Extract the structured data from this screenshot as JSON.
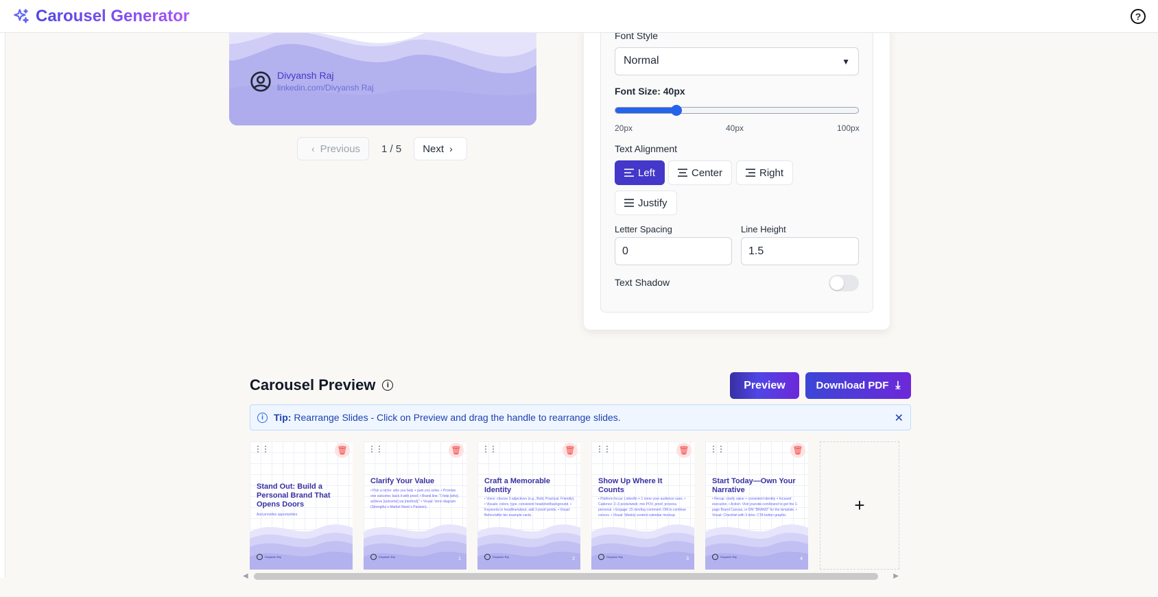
{
  "header": {
    "title": "Carousel Generator",
    "help": "?"
  },
  "editor_preview": {
    "author_name": "Divyansh Raj",
    "author_handle": "linkedin.com/Divyansh Raj",
    "pager": {
      "previous": "Previous",
      "next": "Next",
      "count": "1 / 5"
    }
  },
  "panel": {
    "font_style_label": "Font Style",
    "font_style_value": "Normal",
    "font_size_label": "Font Size: 40px",
    "font_size_fraction": 0.25,
    "slider_ticks": [
      "20px",
      "40px",
      "100px"
    ],
    "text_alignment_label": "Text Alignment",
    "align_left": "Left",
    "align_center": "Center",
    "align_right": "Right",
    "align_justify": "Justify",
    "letter_spacing_label": "Letter Spacing",
    "letter_spacing_value": "0",
    "line_height_label": "Line Height",
    "line_height_value": "1.5",
    "text_shadow_label": "Text Shadow"
  },
  "carousel": {
    "title": "Carousel Preview",
    "preview_button": "Preview",
    "download_button": "Download PDF",
    "tip_label": "Tip:",
    "tip_text": "Rearrange Slides - Click on Preview and drag the handle to rearrange slides.",
    "slides": [
      {
        "title": "Stand Out: Build a Personal Brand That Opens Doors",
        "body": "And provides opportunities",
        "num": "",
        "author": "Divyansh Raj"
      },
      {
        "title": "Clarify Your Value",
        "body": "• Pick a niche: who you help + pain you solve. • Promise one outcome; back it with proof. • Brand line: \"I help [who] achieve [outcome] via [method].\" • Visual: Venn diagram (Strengths x Market Need x Passion).",
        "num": "1",
        "author": "Divyansh Raj"
      },
      {
        "title": "Craft a Memorable Identity",
        "body": "• Voice: choose 3 adjectives (e.g., Bold, Practical, Friendly). • Visuals: colors, type, consistent headshot/background. • Keywords in headline/about; add 3 proof points. • Visual: Before/after bio example cards.",
        "num": "2",
        "author": "Divyansh Raj"
      },
      {
        "title": "Show Up Where It Counts",
        "body": "• Platform focus: LinkedIn + 1 more your audience uses. • Cadence: 2–3 posts/week; mix POV, proof, process, personal. • Engage: 15 min/day comment; DM to continue convos. • Visual: Weekly content calendar mockup.",
        "num": "3",
        "author": "Divyansh Raj"
      },
      {
        "title": "Start Today—Own Your Narrative",
        "body": "• Recap: clarify value + consistent identity + focused execution. • Action: Visit yoursite.com/brand to get the 1-page Brand Canvas, or DM \"BRAND\" for the template. • Visual: Checklist with 3 ticks; CTA button graphic.",
        "num": "4",
        "author": "Divyansh Raj"
      }
    ],
    "add_slide": "+"
  },
  "colors": {
    "accent": "#4338ca",
    "wave": "#b8b5ef",
    "tip_bg": "#eff6ff"
  }
}
